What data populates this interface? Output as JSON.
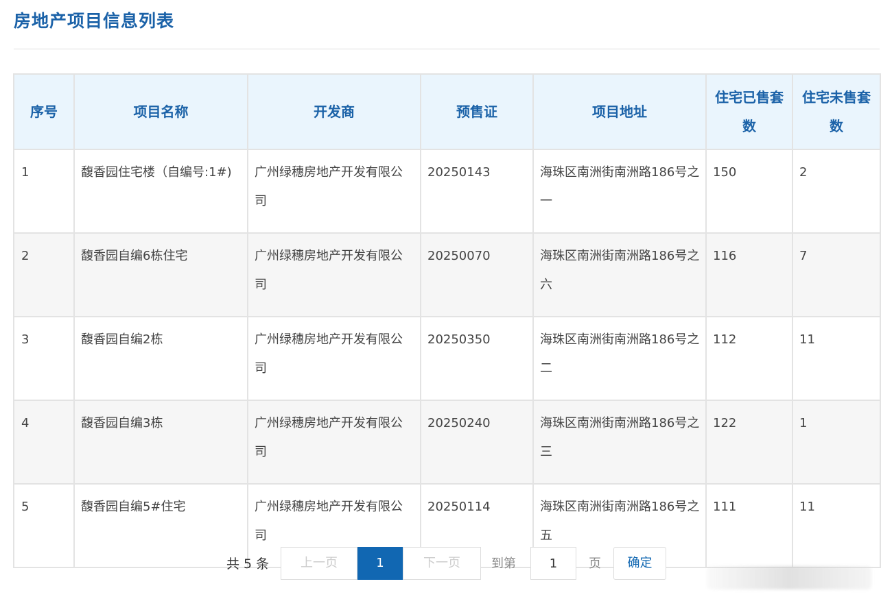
{
  "page": {
    "title": "房地产项目信息列表"
  },
  "table": {
    "headers": {
      "idx": "序号",
      "name": "项目名称",
      "developer": "开发商",
      "permit": "预售证",
      "address": "项目地址",
      "sold": "住宅已售套数",
      "unsold": "住宅未售套数"
    },
    "rows": [
      {
        "idx": "1",
        "name": "馥香园住宅楼（自编号:1#)",
        "developer": "广州绿穗房地产开发有限公司",
        "permit": "20250143",
        "address": "海珠区南洲街南洲路186号之一",
        "sold": "150",
        "unsold": "2"
      },
      {
        "idx": "2",
        "name": "馥香园自编6栋住宅",
        "developer": "广州绿穗房地产开发有限公司",
        "permit": "20250070",
        "address": "海珠区南洲街南洲路186号之六",
        "sold": "116",
        "unsold": "7"
      },
      {
        "idx": "3",
        "name": "馥香园自编2栋",
        "developer": "广州绿穗房地产开发有限公司",
        "permit": "20250350",
        "address": "海珠区南洲街南洲路186号之二",
        "sold": "112",
        "unsold": "11"
      },
      {
        "idx": "4",
        "name": "馥香园自编3栋",
        "developer": "广州绿穗房地产开发有限公司",
        "permit": "20250240",
        "address": "海珠区南洲街南洲路186号之三",
        "sold": "122",
        "unsold": "1"
      },
      {
        "idx": "5",
        "name": "馥香园自编5#住宅",
        "developer": "广州绿穗房地产开发有限公司",
        "permit": "20250114",
        "address": "海珠区南洲街南洲路186号之五",
        "sold": "111",
        "unsold": "11"
      }
    ]
  },
  "pagination": {
    "total": "共 5 条",
    "prev": "上一页",
    "current": "1",
    "next": "下一页",
    "goto_label": "到第",
    "page_input_value": "1",
    "page_unit": "页",
    "confirm": "确定"
  }
}
